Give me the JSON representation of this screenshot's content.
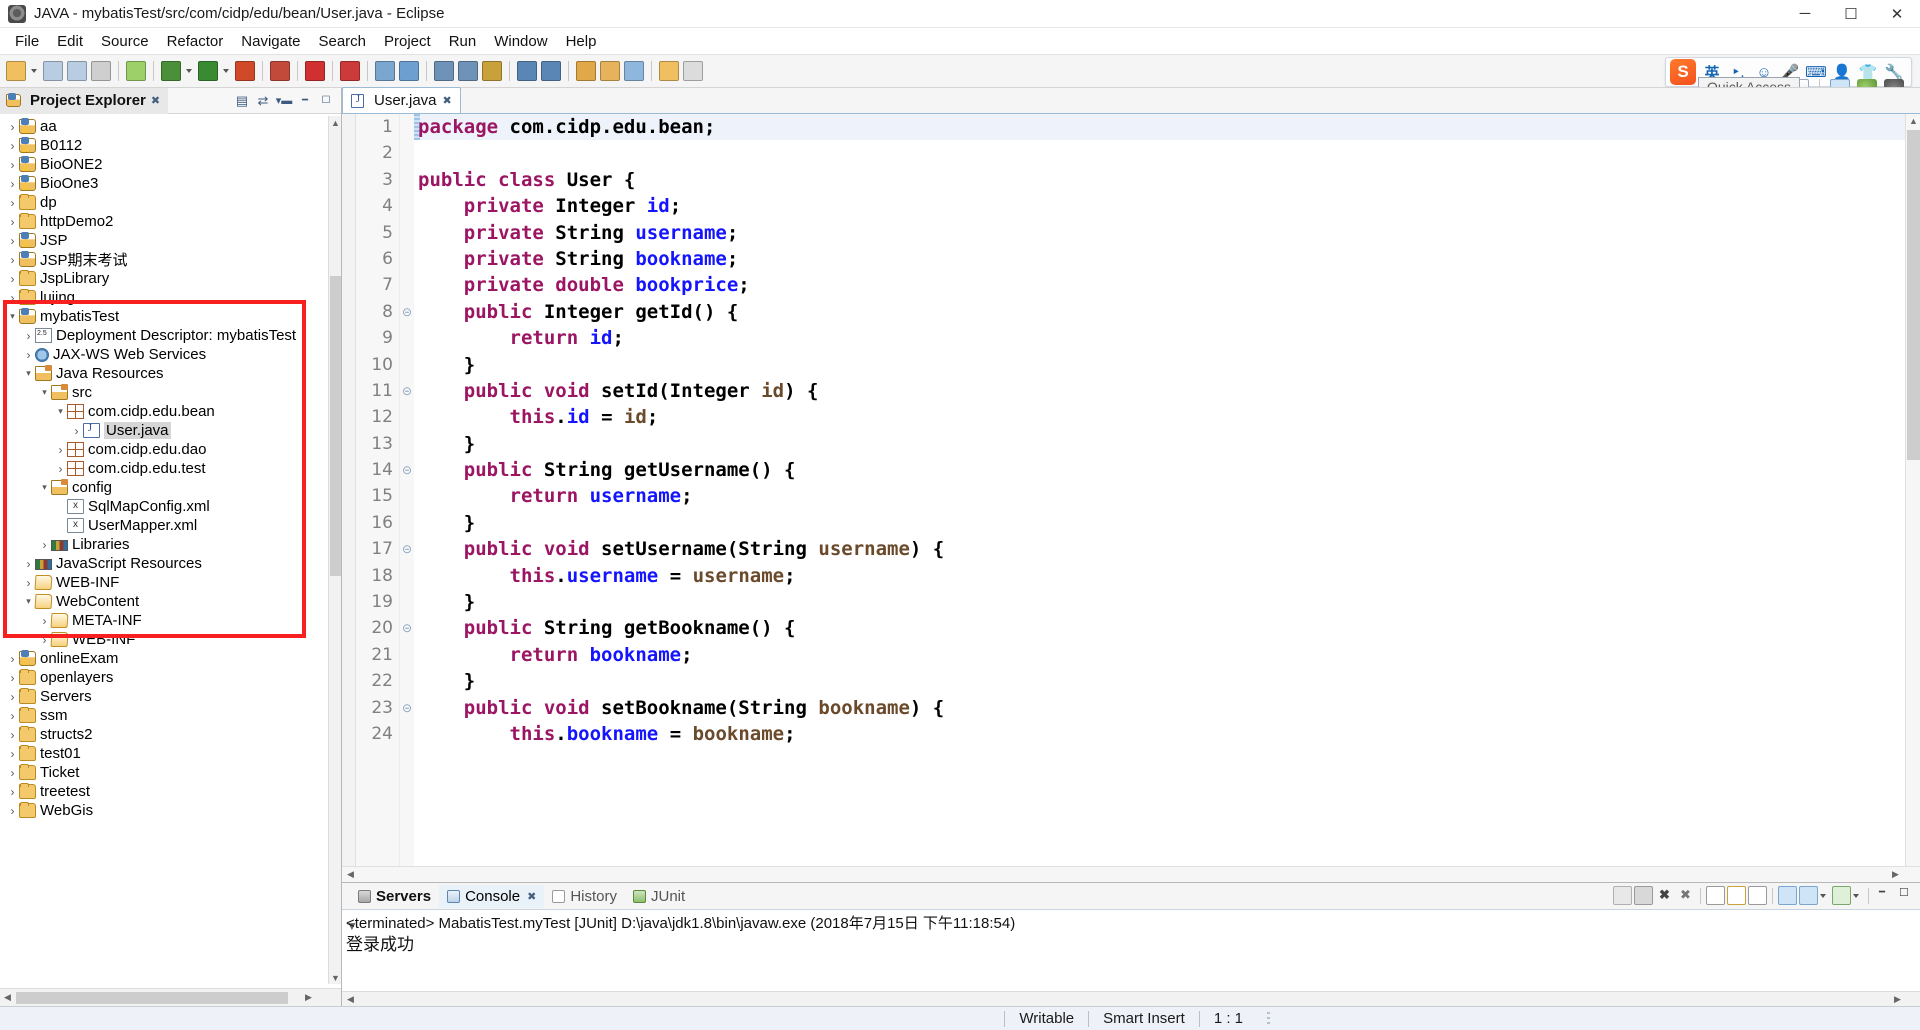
{
  "window": {
    "title": "JAVA - mybatisTest/src/com/cidp/edu/bean/User.java - Eclipse",
    "minimize": "─",
    "maximize": "☐",
    "close": "✕"
  },
  "menubar": {
    "items": [
      "File",
      "Edit",
      "Source",
      "Refactor",
      "Navigate",
      "Search",
      "Project",
      "Run",
      "Window",
      "Help"
    ]
  },
  "toolbar": {
    "quick_access": "Quick Access",
    "sogou": {
      "logo": "S",
      "mode": "英",
      "icons": [
        "punctuation-icon",
        "emoji-icon",
        "voice-input-icon",
        "soft-keyboard-icon",
        "user-card-icon",
        "skin-icon",
        "toolbox-icon"
      ]
    }
  },
  "explorer": {
    "title": "Project Explorer",
    "close_glyph": "✖",
    "tools": [
      "collapse-all-icon",
      "link-with-editor-icon",
      "view-menu-icon"
    ],
    "tree": [
      {
        "label": "aa",
        "indent": 0,
        "arrow": "›",
        "icon": "project-warn"
      },
      {
        "label": "B0112",
        "indent": 0,
        "arrow": "›",
        "icon": "project-warn"
      },
      {
        "label": "BioONE2",
        "indent": 0,
        "arrow": "›",
        "icon": "project-warn"
      },
      {
        "label": "BioOne3",
        "indent": 0,
        "arrow": "›",
        "icon": "project-warn"
      },
      {
        "label": "dp",
        "indent": 0,
        "arrow": "›",
        "icon": "folder"
      },
      {
        "label": "httpDemo2",
        "indent": 0,
        "arrow": "›",
        "icon": "folder"
      },
      {
        "label": "JSP",
        "indent": 0,
        "arrow": "›",
        "icon": "project-warn"
      },
      {
        "label": "JSP期末考试",
        "indent": 0,
        "arrow": "›",
        "icon": "project"
      },
      {
        "label": "JspLibrary",
        "indent": 0,
        "arrow": "›",
        "icon": "folder"
      },
      {
        "label": "lujing",
        "indent": 0,
        "arrow": "›",
        "icon": "folder"
      },
      {
        "label": "mybatisTest",
        "indent": 0,
        "arrow": "⌄",
        "icon": "project"
      },
      {
        "label": "Deployment Descriptor: mybatisTest",
        "indent": 1,
        "arrow": "›",
        "icon": "deployment"
      },
      {
        "label": "JAX-WS Web Services",
        "indent": 1,
        "arrow": "›",
        "icon": "webservice"
      },
      {
        "label": "Java Resources",
        "indent": 1,
        "arrow": "⌄",
        "icon": "srcfolder"
      },
      {
        "label": "src",
        "indent": 2,
        "arrow": "⌄",
        "icon": "srcfolder"
      },
      {
        "label": "com.cidp.edu.bean",
        "indent": 3,
        "arrow": "⌄",
        "icon": "package"
      },
      {
        "label": "User.java",
        "indent": 4,
        "arrow": "›",
        "icon": "javafile",
        "selected": true
      },
      {
        "label": "com.cidp.edu.dao",
        "indent": 3,
        "arrow": "›",
        "icon": "package"
      },
      {
        "label": "com.cidp.edu.test",
        "indent": 3,
        "arrow": "›",
        "icon": "package"
      },
      {
        "label": "config",
        "indent": 2,
        "arrow": "⌄",
        "icon": "srcfolder"
      },
      {
        "label": "SqlMapConfig.xml",
        "indent": 3,
        "arrow": "",
        "icon": "xmlfile"
      },
      {
        "label": "UserMapper.xml",
        "indent": 3,
        "arrow": "",
        "icon": "xmlfile"
      },
      {
        "label": "Libraries",
        "indent": 2,
        "arrow": "›",
        "icon": "library"
      },
      {
        "label": "JavaScript Resources",
        "indent": 1,
        "arrow": "›",
        "icon": "library"
      },
      {
        "label": "WEB-INF",
        "indent": 1,
        "arrow": "›",
        "icon": "folderopen"
      },
      {
        "label": "WebContent",
        "indent": 1,
        "arrow": "⌄",
        "icon": "folderopen"
      },
      {
        "label": "META-INF",
        "indent": 2,
        "arrow": "›",
        "icon": "folderopen"
      },
      {
        "label": "WEB-INF",
        "indent": 2,
        "arrow": "›",
        "icon": "folderopen"
      },
      {
        "label": "onlineExam",
        "indent": 0,
        "arrow": "›",
        "icon": "project-warn"
      },
      {
        "label": "openlayers",
        "indent": 0,
        "arrow": "›",
        "icon": "folder"
      },
      {
        "label": "Servers",
        "indent": 0,
        "arrow": "›",
        "icon": "folder"
      },
      {
        "label": "ssm",
        "indent": 0,
        "arrow": "›",
        "icon": "folder"
      },
      {
        "label": "structs2",
        "indent": 0,
        "arrow": "›",
        "icon": "folder"
      },
      {
        "label": "test01",
        "indent": 0,
        "arrow": "›",
        "icon": "folder"
      },
      {
        "label": "Ticket",
        "indent": 0,
        "arrow": "›",
        "icon": "folder"
      },
      {
        "label": "treetest",
        "indent": 0,
        "arrow": "›",
        "icon": "folder"
      },
      {
        "label": "WebGis",
        "indent": 0,
        "arrow": "›",
        "icon": "folder"
      }
    ]
  },
  "editor": {
    "tab_label": "User.java",
    "tab_close": "✖",
    "lines": [
      {
        "n": "1",
        "fold": "",
        "tokens": [
          {
            "t": "package ",
            "c": "kw"
          },
          {
            "t": "com.cidp.edu.bean;",
            "c": "pl"
          }
        ]
      },
      {
        "n": "2",
        "fold": "",
        "tokens": []
      },
      {
        "n": "3",
        "fold": "",
        "tokens": [
          {
            "t": "public class ",
            "c": "kw"
          },
          {
            "t": "User {",
            "c": "pl"
          }
        ]
      },
      {
        "n": "4",
        "fold": "",
        "tokens": [
          {
            "t": "    private ",
            "c": "kw"
          },
          {
            "t": "Integer ",
            "c": "pl"
          },
          {
            "t": "id",
            "c": "fld"
          },
          {
            "t": ";",
            "c": "pl"
          }
        ]
      },
      {
        "n": "5",
        "fold": "",
        "tokens": [
          {
            "t": "    private ",
            "c": "kw"
          },
          {
            "t": "String ",
            "c": "pl"
          },
          {
            "t": "username",
            "c": "fld"
          },
          {
            "t": ";",
            "c": "pl"
          }
        ]
      },
      {
        "n": "6",
        "fold": "",
        "tokens": [
          {
            "t": "    private ",
            "c": "kw"
          },
          {
            "t": "String ",
            "c": "pl"
          },
          {
            "t": "bookname",
            "c": "fld"
          },
          {
            "t": ";",
            "c": "pl"
          }
        ]
      },
      {
        "n": "7",
        "fold": "",
        "tokens": [
          {
            "t": "    private double ",
            "c": "kw"
          },
          {
            "t": "bookprice",
            "c": "fld"
          },
          {
            "t": ";",
            "c": "pl"
          }
        ]
      },
      {
        "n": "8",
        "fold": "⊝",
        "tokens": [
          {
            "t": "    public ",
            "c": "kw"
          },
          {
            "t": "Integer getId() {",
            "c": "pl"
          }
        ]
      },
      {
        "n": "9",
        "fold": "",
        "tokens": [
          {
            "t": "        return ",
            "c": "kw"
          },
          {
            "t": "id",
            "c": "fld"
          },
          {
            "t": ";",
            "c": "pl"
          }
        ]
      },
      {
        "n": "10",
        "fold": "",
        "tokens": [
          {
            "t": "    }",
            "c": "pl"
          }
        ]
      },
      {
        "n": "11",
        "fold": "⊝",
        "tokens": [
          {
            "t": "    public void ",
            "c": "kw"
          },
          {
            "t": "setId(Integer ",
            "c": "pl"
          },
          {
            "t": "id",
            "c": "loc"
          },
          {
            "t": ") {",
            "c": "pl"
          }
        ]
      },
      {
        "n": "12",
        "fold": "",
        "tokens": [
          {
            "t": "        this",
            "c": "kw"
          },
          {
            "t": ".",
            "c": "pl"
          },
          {
            "t": "id",
            "c": "fld"
          },
          {
            "t": " = ",
            "c": "pl"
          },
          {
            "t": "id",
            "c": "loc"
          },
          {
            "t": ";",
            "c": "pl"
          }
        ]
      },
      {
        "n": "13",
        "fold": "",
        "tokens": [
          {
            "t": "    }",
            "c": "pl"
          }
        ]
      },
      {
        "n": "14",
        "fold": "⊝",
        "tokens": [
          {
            "t": "    public ",
            "c": "kw"
          },
          {
            "t": "String getUsername() {",
            "c": "pl"
          }
        ]
      },
      {
        "n": "15",
        "fold": "",
        "tokens": [
          {
            "t": "        return ",
            "c": "kw"
          },
          {
            "t": "username",
            "c": "fld"
          },
          {
            "t": ";",
            "c": "pl"
          }
        ]
      },
      {
        "n": "16",
        "fold": "",
        "tokens": [
          {
            "t": "    }",
            "c": "pl"
          }
        ]
      },
      {
        "n": "17",
        "fold": "⊝",
        "tokens": [
          {
            "t": "    public void ",
            "c": "kw"
          },
          {
            "t": "setUsername(String ",
            "c": "pl"
          },
          {
            "t": "username",
            "c": "loc"
          },
          {
            "t": ") {",
            "c": "pl"
          }
        ]
      },
      {
        "n": "18",
        "fold": "",
        "tokens": [
          {
            "t": "        this",
            "c": "kw"
          },
          {
            "t": ".",
            "c": "pl"
          },
          {
            "t": "username",
            "c": "fld"
          },
          {
            "t": " = ",
            "c": "pl"
          },
          {
            "t": "username",
            "c": "loc"
          },
          {
            "t": ";",
            "c": "pl"
          }
        ]
      },
      {
        "n": "19",
        "fold": "",
        "tokens": [
          {
            "t": "    }",
            "c": "pl"
          }
        ]
      },
      {
        "n": "20",
        "fold": "⊝",
        "tokens": [
          {
            "t": "    public ",
            "c": "kw"
          },
          {
            "t": "String getBookname() {",
            "c": "pl"
          }
        ]
      },
      {
        "n": "21",
        "fold": "",
        "tokens": [
          {
            "t": "        return ",
            "c": "kw"
          },
          {
            "t": "bookname",
            "c": "fld"
          },
          {
            "t": ";",
            "c": "pl"
          }
        ]
      },
      {
        "n": "22",
        "fold": "",
        "tokens": [
          {
            "t": "    }",
            "c": "pl"
          }
        ]
      },
      {
        "n": "23",
        "fold": "⊝",
        "tokens": [
          {
            "t": "    public void ",
            "c": "kw"
          },
          {
            "t": "setBookname(String ",
            "c": "pl"
          },
          {
            "t": "bookname",
            "c": "loc"
          },
          {
            "t": ") {",
            "c": "pl"
          }
        ]
      },
      {
        "n": "24",
        "fold": "",
        "tokens": [
          {
            "t": "        this",
            "c": "kw"
          },
          {
            "t": ".",
            "c": "pl"
          },
          {
            "t": "bookname",
            "c": "fld"
          },
          {
            "t": " = ",
            "c": "pl"
          },
          {
            "t": "bookname",
            "c": "loc"
          },
          {
            "t": ";",
            "c": "pl"
          }
        ]
      }
    ]
  },
  "console": {
    "tabs": [
      {
        "label": "Servers",
        "active": false,
        "bold": true,
        "icon": "servers-icon",
        "close": ""
      },
      {
        "label": "Console",
        "active": true,
        "bold": false,
        "icon": "console-icon",
        "close": "✖"
      },
      {
        "label": "History",
        "active": false,
        "bold": false,
        "icon": "history-icon",
        "close": ""
      },
      {
        "label": "JUnit",
        "active": false,
        "bold": false,
        "icon": "junit-icon",
        "close": ""
      }
    ],
    "output": [
      "<terminated> MabatisTest.myTest [JUnit] D:\\java\\jdk1.8\\bin\\javaw.exe (2018年7月15日 下午11:18:54)",
      "登录成功"
    ],
    "tools": [
      "terminate-all-icon",
      "remove-launch-icon",
      "remove-all-terminated-icon",
      "clear-console-icon",
      "scroll-lock-icon",
      "pin-console-icon",
      "show-console-on-output-icon",
      "display-selected-console-icon",
      "open-console-icon",
      "new-console-view-icon",
      "minimize-icon",
      "maximize-icon"
    ]
  },
  "statusbar": {
    "writable": "Writable",
    "insert_mode": "Smart Insert",
    "position": "1 : 1"
  }
}
